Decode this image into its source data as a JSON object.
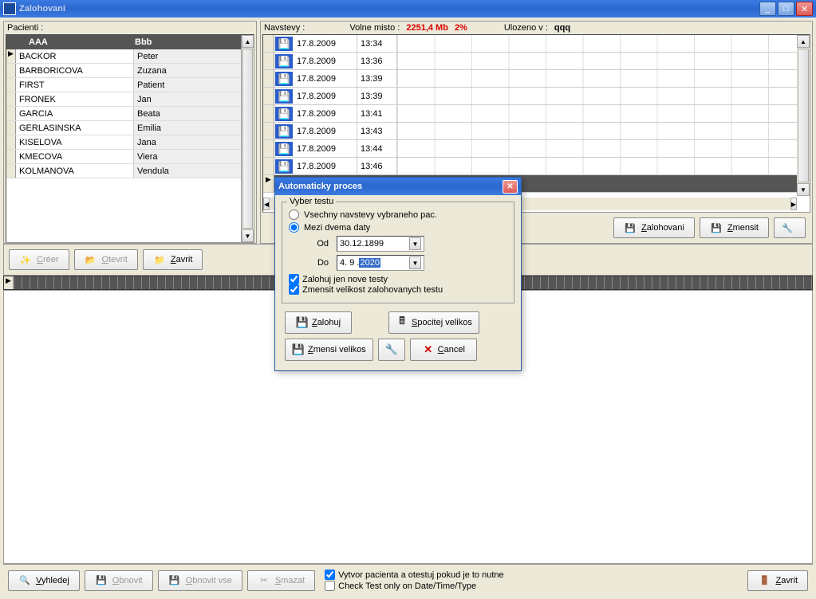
{
  "titlebar": {
    "title": "Zalohovani"
  },
  "patients": {
    "label": "Pacienti :",
    "headers": [
      "AAA",
      "Bbb"
    ],
    "rows": [
      {
        "surname": "BACKOR",
        "name": "Peter"
      },
      {
        "surname": "BARBORICOVA",
        "name": "Zuzana"
      },
      {
        "surname": "FIRST",
        "name": "Patient"
      },
      {
        "surname": "FRONEK",
        "name": "Jan"
      },
      {
        "surname": "GARCIA",
        "name": "Beata"
      },
      {
        "surname": "GERLASINSKA",
        "name": "Emilia"
      },
      {
        "surname": "KISELOVA",
        "name": "Jana"
      },
      {
        "surname": "KMECOVA",
        "name": "Viera"
      },
      {
        "surname": "KOLMANOVA",
        "name": "Vendula"
      }
    ]
  },
  "visits": {
    "label": "Navstevy :",
    "free_label": "Volne misto :",
    "free_value": "2251,4 Mb",
    "free_pct": "2%",
    "saved_label": "Ulozeno v :",
    "saved_value": "qqq",
    "rows": [
      {
        "date": "17.8.2009",
        "time": "13:34"
      },
      {
        "date": "17.8.2009",
        "time": "13:36"
      },
      {
        "date": "17.8.2009",
        "time": "13:39"
      },
      {
        "date": "17.8.2009",
        "time": "13:39"
      },
      {
        "date": "17.8.2009",
        "time": "13:41"
      },
      {
        "date": "17.8.2009",
        "time": "13:43"
      },
      {
        "date": "17.8.2009",
        "time": "13:44"
      },
      {
        "date": "17.8.2009",
        "time": "13:46"
      }
    ],
    "buttons": {
      "zalohovani": "Zalohovani",
      "zmensit": "Zmensit"
    }
  },
  "toolbar2": {
    "creer": "Créer",
    "otevrit": "Otevrit",
    "zavrit": "Zavrit",
    "pct": "%"
  },
  "dialog": {
    "title": "Automaticky proces",
    "legend": "Vyber testu",
    "radio_all": "Vsechny navstevy vybraneho pac.",
    "radio_between": "Mezi dvema daty",
    "od_label": "Od",
    "od_value": "30.12.1899",
    "do_label": "Do",
    "do_value_pre": " 4. 9 .",
    "do_value_sel": "2020",
    "chk_new": "Zalohuj jen nove testy",
    "chk_shrink": "Zmensit velikost zalohovanych testu",
    "btn_zalohuj": "Zalohuj",
    "btn_spocitej": "Spocitej velikos",
    "btn_zmensi": "Zmensi velikos",
    "btn_cancel": "Cancel"
  },
  "bottom": {
    "vyhledej": "Vyhledej",
    "obnovit": "Obnovit",
    "obnovit_vse": "Obnovit vse",
    "smazat": "Smazat",
    "chk1": "Vytvor pacienta a otestuj pokud je to nutne",
    "chk2": "Check Test only on Date/Time/Type",
    "zavrit": "Zavrit"
  }
}
